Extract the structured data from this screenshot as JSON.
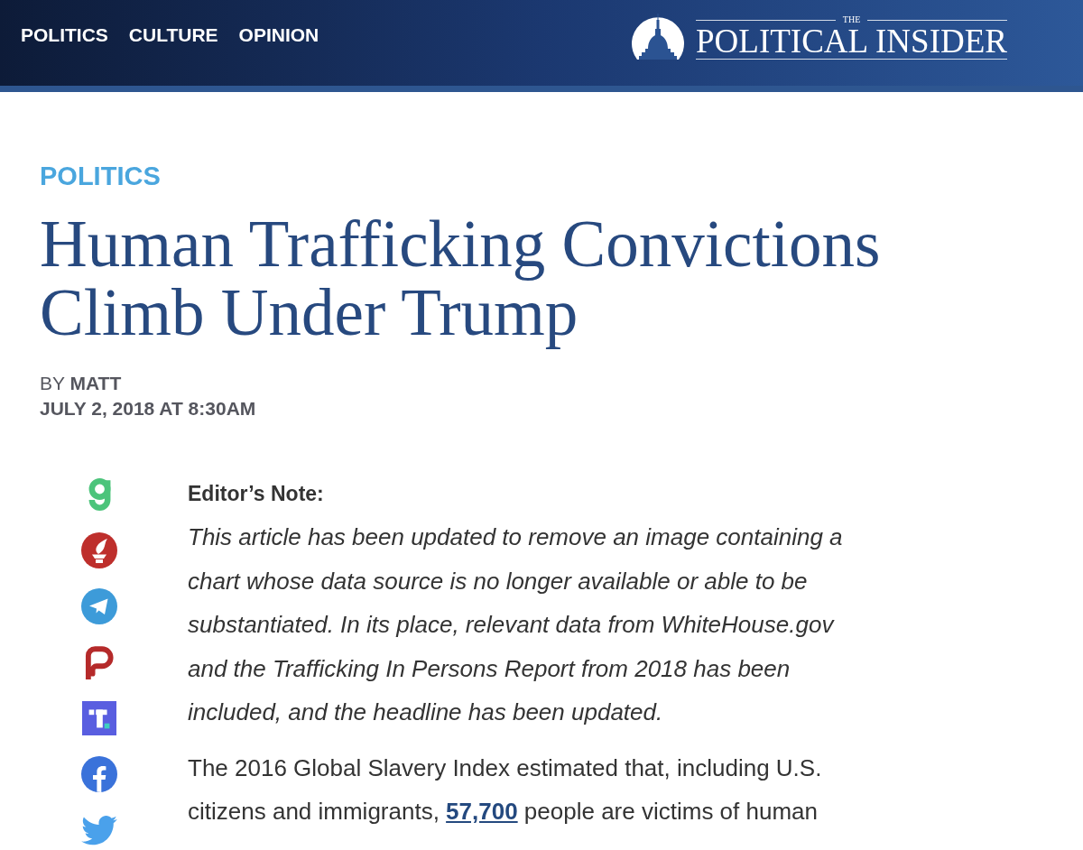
{
  "header": {
    "nav": [
      {
        "label": "POLITICS"
      },
      {
        "label": "CULTURE"
      },
      {
        "label": "OPINION"
      }
    ],
    "logo": {
      "small": "THE",
      "title": "POLITICAL INSIDER"
    }
  },
  "article": {
    "category": "POLITICS",
    "headline": "Human Trafficking Convictions Climb Under Trump",
    "byline": "BY **MATT**",
    "date": "JULY 2, 2018 AT 8:30AM",
    "share_buttons": [
      {
        "kind": "g"
      },
      {
        "kind": "torch"
      },
      {
        "kind": "plane"
      },
      {
        "kind": "p"
      },
      {
        "kind": "t"
      },
      {
        "kind": "f"
      },
      {
        "kind": "bird"
      }
    ],
    "editor_note": {
      "heading": "Editor’s Note:",
      "text": "This article has been updated to remove an image containing a chart whose data source is no longer available or able to be substantiated. In its place, relevant data from WhiteHouse.gov and the Trafficking In Persons Report from 2018 has been included, and the headline has been updated."
    },
    "paragraph": {
      "text_before": "The 2016 Global Slavery Index estimated that, including U.S. citizens and immigrants,",
      "link": "57,700",
      "text_after": "people are victims of human"
    }
  }
}
